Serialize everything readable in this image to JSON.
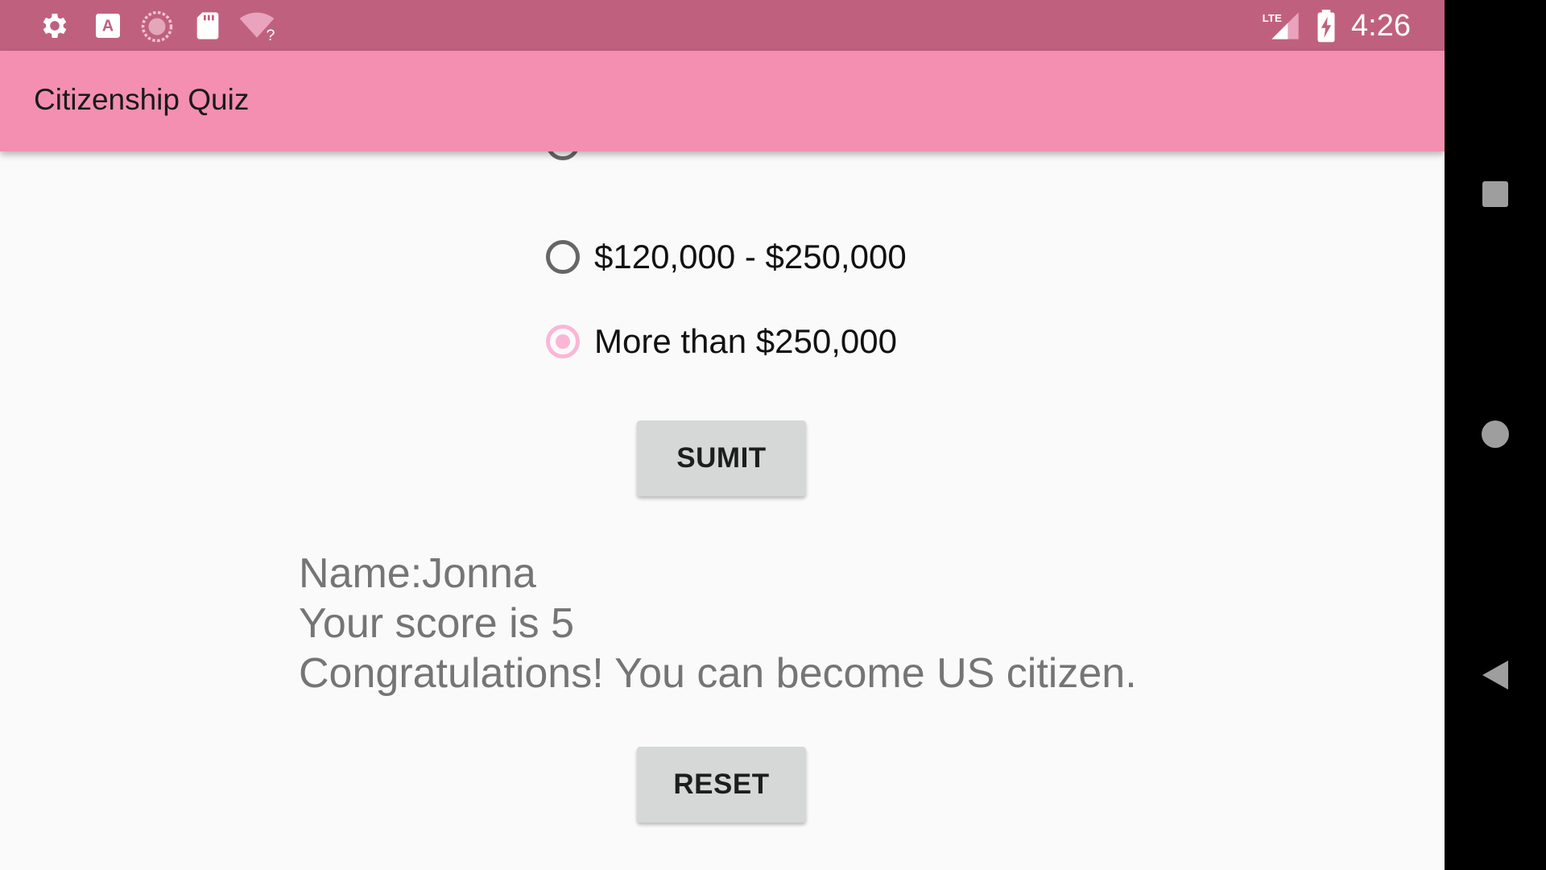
{
  "status_bar": {
    "time": "4:26",
    "network_label": "LTE",
    "left_icons": [
      "gear-icon",
      "keyboard-a-icon",
      "sync-circle-icon",
      "sd-card-icon",
      "wifi-unknown-icon"
    ],
    "right_icons": [
      "signal-lte-icon",
      "battery-charging-icon"
    ],
    "color": "#c0607f"
  },
  "app_bar": {
    "title": "Citizenship Quiz",
    "color": "#f48fb1"
  },
  "question": {
    "options": [
      {
        "label": "",
        "checked": false,
        "partial": true
      },
      {
        "label": "$120,000 - $250,000",
        "checked": false
      },
      {
        "label": "More than $250,000",
        "checked": true
      }
    ],
    "accent": "#fbb6d6"
  },
  "buttons": {
    "submit_label": "SUMIT",
    "reset_label": "RESET"
  },
  "result": {
    "name_line": "Name:Jonna",
    "score_line": "Your score is 5",
    "message_line": "Congratulations! You can become US citizen."
  },
  "nav_bar": {
    "icons": [
      "recents-square-icon",
      "home-circle-icon",
      "back-triangle-icon"
    ]
  }
}
